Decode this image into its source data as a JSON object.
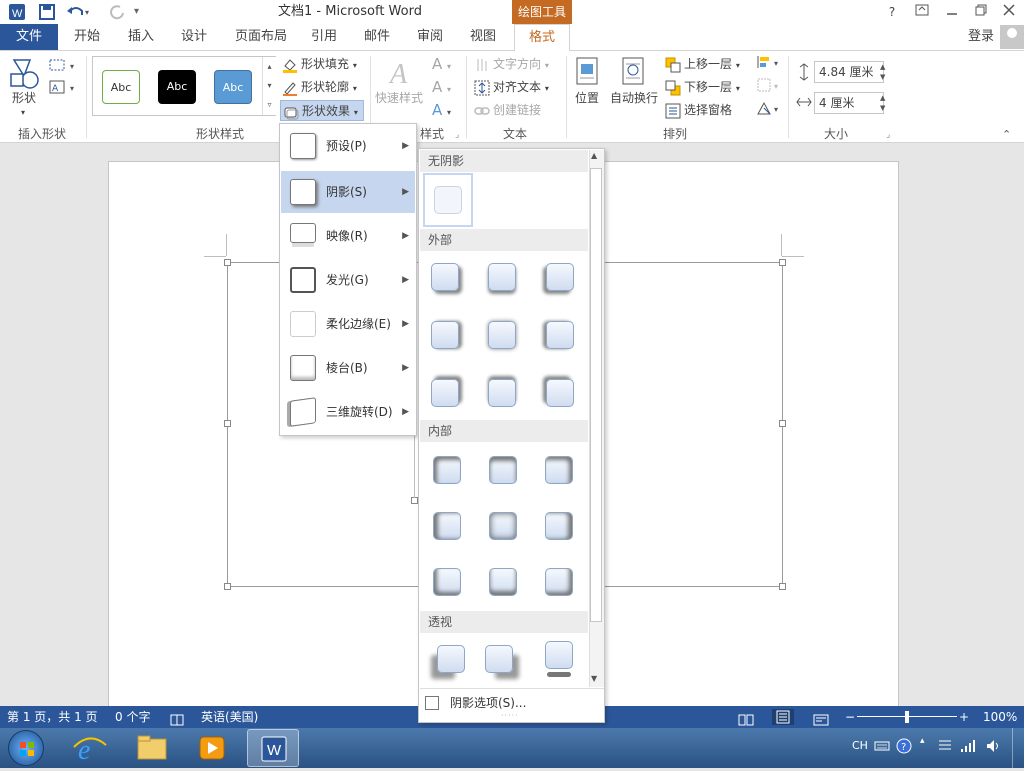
{
  "titlebar": {
    "doc_title": "文档1 - Microsoft Word",
    "context_tab": "绘图工具",
    "help": "?"
  },
  "tabs": {
    "file": "文件",
    "items": [
      "开始",
      "插入",
      "设计",
      "页面布局",
      "引用",
      "邮件",
      "审阅",
      "视图"
    ],
    "format": "格式",
    "login": "登录"
  },
  "ribbon": {
    "insert_shape": {
      "shape_label": "形状",
      "group": "插入形状"
    },
    "shape_styles": {
      "gallery": [
        "Abc",
        "Abc",
        "Abc"
      ],
      "fill": "形状填充",
      "outline": "形状轮廓",
      "effects": "形状效果",
      "group": "形状样式"
    },
    "wordart": {
      "quick_styles": "快速样式",
      "group_partial": "样式"
    },
    "text": {
      "direction": "文字方向",
      "align": "对齐文本",
      "link": "创建链接",
      "group": "文本"
    },
    "arrange": {
      "position": "位置",
      "wrap": "自动换行",
      "forward": "上移一层",
      "backward": "下移一层",
      "pane": "选择窗格",
      "group": "排列"
    },
    "size": {
      "height": "4.84 厘米",
      "width": "4 厘米",
      "group": "大小"
    }
  },
  "effects_menu": [
    {
      "label": "预设(P)"
    },
    {
      "label": "阴影(S)",
      "active": true
    },
    {
      "label": "映像(R)"
    },
    {
      "label": "发光(G)"
    },
    {
      "label": "柔化边缘(E)"
    },
    {
      "label": "棱台(B)"
    },
    {
      "label": "三维旋转(D)"
    }
  ],
  "shadow_panel": {
    "no_shadow": "无阴影",
    "outer": "外部",
    "inner": "内部",
    "perspective": "透视",
    "options": "阴影选项(S)..."
  },
  "statusbar": {
    "page": "第 1 页，共 1 页",
    "words": "0 个字",
    "language": "英语(美国)",
    "zoom": "100%",
    "zoom_value": 100
  },
  "taskbar": {
    "lang": "CH"
  },
  "colors": {
    "accent": "#2b579a",
    "context": "#c46a22",
    "active_menu": "#c5d6ee"
  }
}
